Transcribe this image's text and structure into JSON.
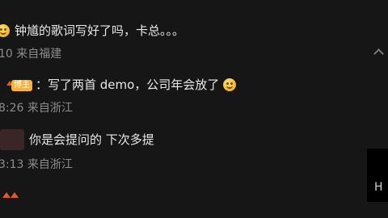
{
  "comments": [
    {
      "text": "钟馗的歌词写好了吗，卡总。。。",
      "meta": "10  来自福建",
      "leading_icon": "cat-face-emoji-icon"
    },
    {
      "badge": "博主",
      "text": "：写了两首 demo，公司年会放了",
      "meta": "8:26  来自浙江",
      "trailing_icon": "smile-emoji-icon"
    },
    {
      "text": "你是会提问的  下次多提",
      "meta": "3:13  来自浙江"
    }
  ],
  "side_panel": {
    "glyph": "H"
  },
  "colors": {
    "background": "#161616",
    "meta_text": "#8c8c8c",
    "badge": "#f6b23a",
    "accent": "#e05a2b"
  }
}
